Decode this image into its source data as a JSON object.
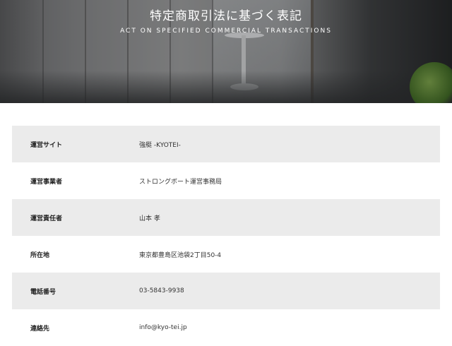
{
  "hero": {
    "title": "特定商取引法に基づく表記",
    "subtitle": "ACT ON SPECIFIED COMMERCIAL TRANSACTIONS"
  },
  "rows": [
    {
      "label": "運営サイト",
      "value": "強艇 -KYOTEI-"
    },
    {
      "label": "運営事業者",
      "value": "ストロングボート運営事務局"
    },
    {
      "label": "運営責任者",
      "value": "山本 孝"
    },
    {
      "label": "所在地",
      "value": "東京都豊島区池袋2丁目50-4"
    },
    {
      "label": "電話番号",
      "value": "03-5843-9938"
    },
    {
      "label": "連絡先",
      "value": "info@kyo-tei.jp"
    }
  ]
}
